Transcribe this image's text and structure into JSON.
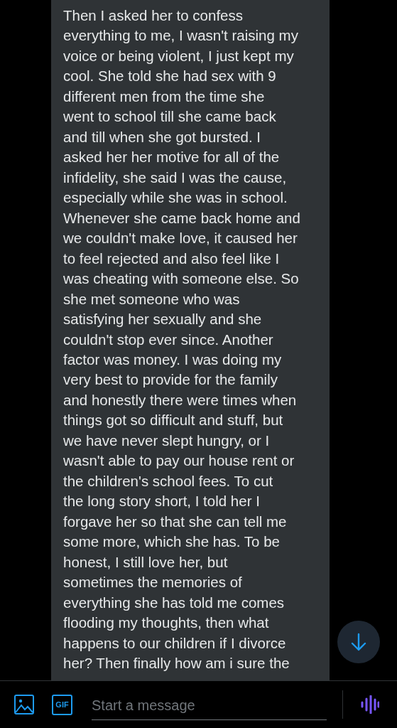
{
  "message": {
    "lines": [
      "Then I asked her to confess",
      "everything to me, I wasn't raising my",
      "voice or being violent, I just kept my",
      "cool. She told she had sex with 9",
      "different men from the time she",
      "went to school till she came back",
      "and till when she got bursted. I",
      "asked her her motive for all of the",
      "infidelity, she said I was the cause,",
      "especially while she was in school.",
      "Whenever she came back home and",
      "we couldn't make love, it caused her",
      "to feel rejected and also feel like I",
      "was cheating with someone else. So",
      "she met someone who was",
      "satisfying her sexually and she",
      "couldn't stop ever since. Another",
      "factor was money. I was doing my",
      "very best to provide for the family",
      "and honestly there were times when",
      "things got so difficult and stuff, but",
      "we have never slept hungry, or I",
      "wasn't able to pay our house rent or",
      "the children's school fees. To cut",
      "the long story short, I told her I",
      "forgave her so that she can tell me",
      "some more, which she has. To be",
      "honest, I still love her, but",
      "sometimes the memories of",
      "everything she has told me comes",
      "flooding my thoughts, then what",
      "happens to our children if I divorce",
      "her? Then finally how am i sure the"
    ]
  },
  "composer": {
    "gif_label": "GIF",
    "placeholder": "Start a message"
  }
}
